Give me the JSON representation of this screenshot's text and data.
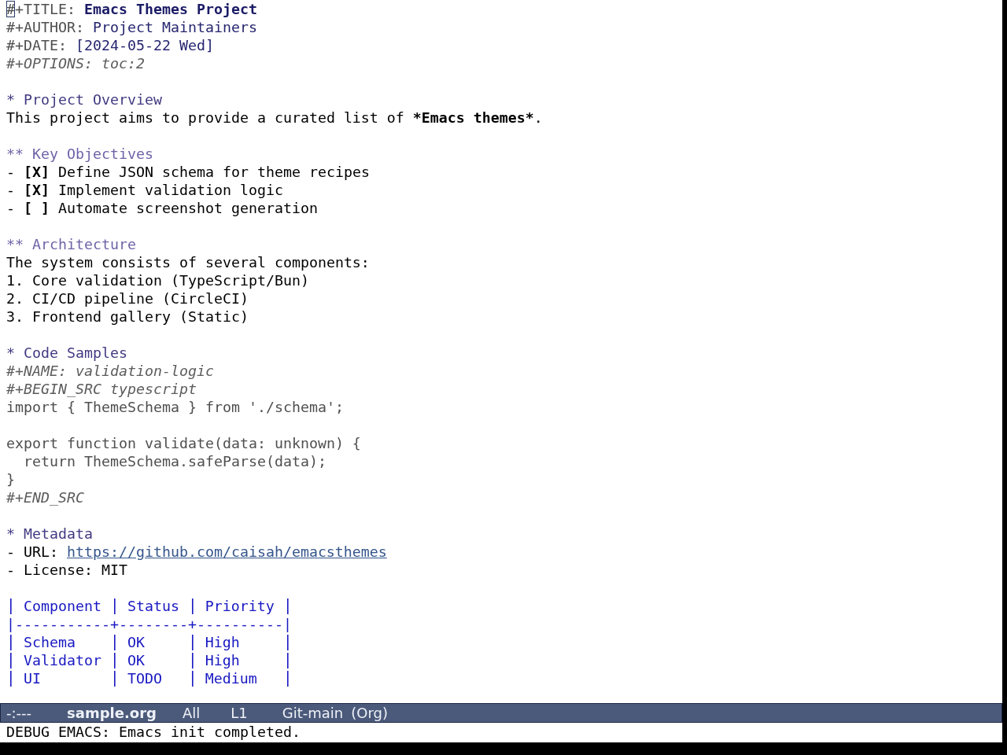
{
  "buffer": {
    "header": [
      {
        "kind": "title",
        "key": "#+TITLE:",
        "value": "Emacs Themes Project",
        "cursor": true
      },
      {
        "kind": "keyword",
        "key": "#+AUTHOR:",
        "value": "Project Maintainers",
        "cursor": false
      },
      {
        "kind": "keyword",
        "key": "#+DATE:",
        "value": "[2024-05-22 Wed]",
        "cursor": false
      },
      {
        "kind": "meta",
        "text": "#+OPTIONS: toc:2",
        "cursor": false
      }
    ],
    "sections": [
      {
        "heading": "* Project Overview",
        "body": [
          {
            "kind": "paragraph",
            "parts": [
              {
                "text": "This project aims to provide a curated list of ",
                "bold": false
              },
              {
                "text": "*Emacs themes*",
                "bold": true
              },
              {
                "text": ".",
                "bold": false
              }
            ]
          }
        ],
        "children": [
          {
            "heading": "** Key Objectives",
            "body": [
              {
                "kind": "checkbox",
                "text": "- **[X]** Define JSON schema for theme recipes"
              },
              {
                "kind": "checkbox",
                "text": "- **[X]** Implement validation logic"
              },
              {
                "kind": "checkbox",
                "text": "- **[ ]** Automate screenshot generation"
              }
            ]
          },
          {
            "heading": "** Architecture",
            "body": [
              {
                "kind": "text",
                "text": "The system consists of several components:"
              },
              {
                "kind": "text",
                "text": "1. Core validation (TypeScript/Bun)"
              },
              {
                "kind": "text",
                "text": "2. CI/CD pipeline (CircleCI)"
              },
              {
                "kind": "text",
                "text": "3. Frontend gallery (Static)"
              }
            ]
          }
        ]
      },
      {
        "heading": "* Code Samples",
        "body": [
          {
            "kind": "meta",
            "text": "#+NAME: validation-logic"
          },
          {
            "kind": "meta",
            "text": "#+BEGIN_SRC typescript"
          },
          {
            "kind": "code",
            "text": "import { ThemeSchema } from './schema';"
          },
          {
            "kind": "blank"
          },
          {
            "kind": "code",
            "text": "export function validate(data: unknown) {",
            "children": [
              {
                "kind": "code",
                "text": "return ThemeSchema.safeParse(data);"
              }
            ]
          },
          {
            "kind": "code",
            "text": "}"
          },
          {
            "kind": "meta",
            "text": "#+END_SRC"
          }
        ]
      },
      {
        "heading": "* Metadata",
        "body": [
          {
            "kind": "link",
            "label": "- URL:",
            "url": "https://github.com/caisah/emacsthemes"
          },
          {
            "kind": "text",
            "text": "- License: MIT"
          },
          {
            "kind": "blank"
          },
          {
            "kind": "table",
            "columns": [
              "Component",
              "Status",
              "Priority"
            ],
            "rule": "|-----------+--------+----------|",
            "rows": [
              [
                "Schema",
                "OK",
                "High"
              ],
              [
                "Validator",
                "OK",
                "High"
              ],
              [
                "UI",
                "TODO",
                "Medium"
              ]
            ]
          }
        ]
      }
    ]
  },
  "mode_line": {
    "status": "-:---",
    "buffer_name": "sample.org",
    "position": "All",
    "line": "L1",
    "vc": "Git-main",
    "major_mode": "(Org)"
  },
  "echo_area": {
    "message": "DEBUG EMACS: Emacs init completed."
  }
}
